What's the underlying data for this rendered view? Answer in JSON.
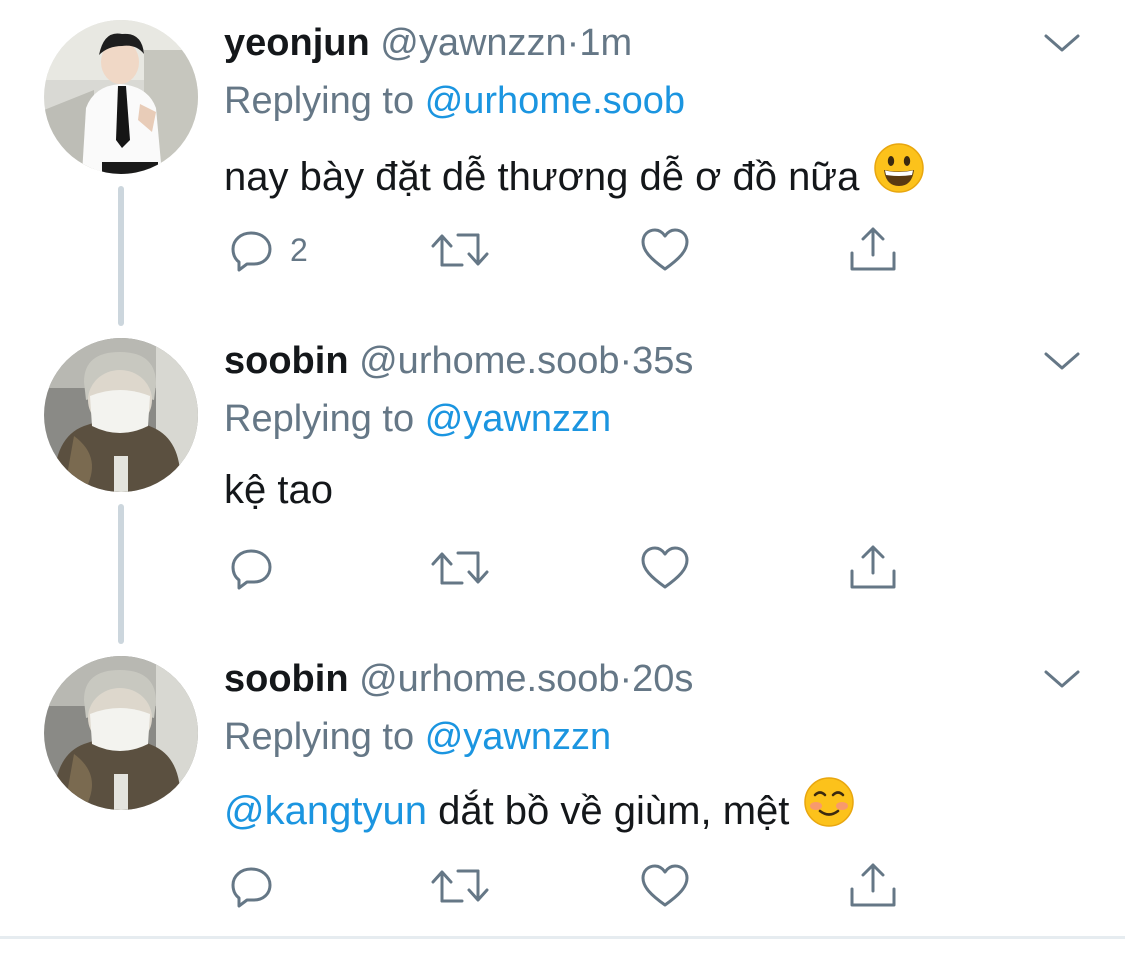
{
  "colors": {
    "text": "#14171a",
    "muted": "#657786",
    "link": "#1b95e0",
    "thread_line": "#ccd6dd"
  },
  "tweets": [
    {
      "name": "yeonjun",
      "handle": "@yawnzzn",
      "dot": "·",
      "time": "1m",
      "replying_prefix": "Replying to",
      "replying_to": "@urhome.soob",
      "mention": "",
      "text": "nay bày đặt dễ thương dễ ơ đồ nữa",
      "emoji": "grinning-face-icon",
      "reply_count": "2",
      "avatar_icon": "avatar-yeonjun"
    },
    {
      "name": "soobin",
      "handle": "@urhome.soob",
      "dot": "·",
      "time": "35s",
      "replying_prefix": "Replying to",
      "replying_to": "@yawnzzn",
      "mention": "",
      "text": "kệ tao",
      "emoji": "",
      "reply_count": "",
      "avatar_icon": "avatar-soobin"
    },
    {
      "name": "soobin",
      "handle": "@urhome.soob",
      "dot": "·",
      "time": "20s",
      "replying_prefix": "Replying to",
      "replying_to": "@yawnzzn",
      "mention": "@kangtyun",
      "text": "dắt bồ về giùm, mệt",
      "emoji": "smiling-face-icon",
      "reply_count": "",
      "avatar_icon": "avatar-soobin"
    }
  ],
  "icons": {
    "reply": "reply-icon",
    "retweet": "retweet-icon",
    "like": "heart-icon",
    "share": "share-icon",
    "more": "chevron-down-icon"
  }
}
